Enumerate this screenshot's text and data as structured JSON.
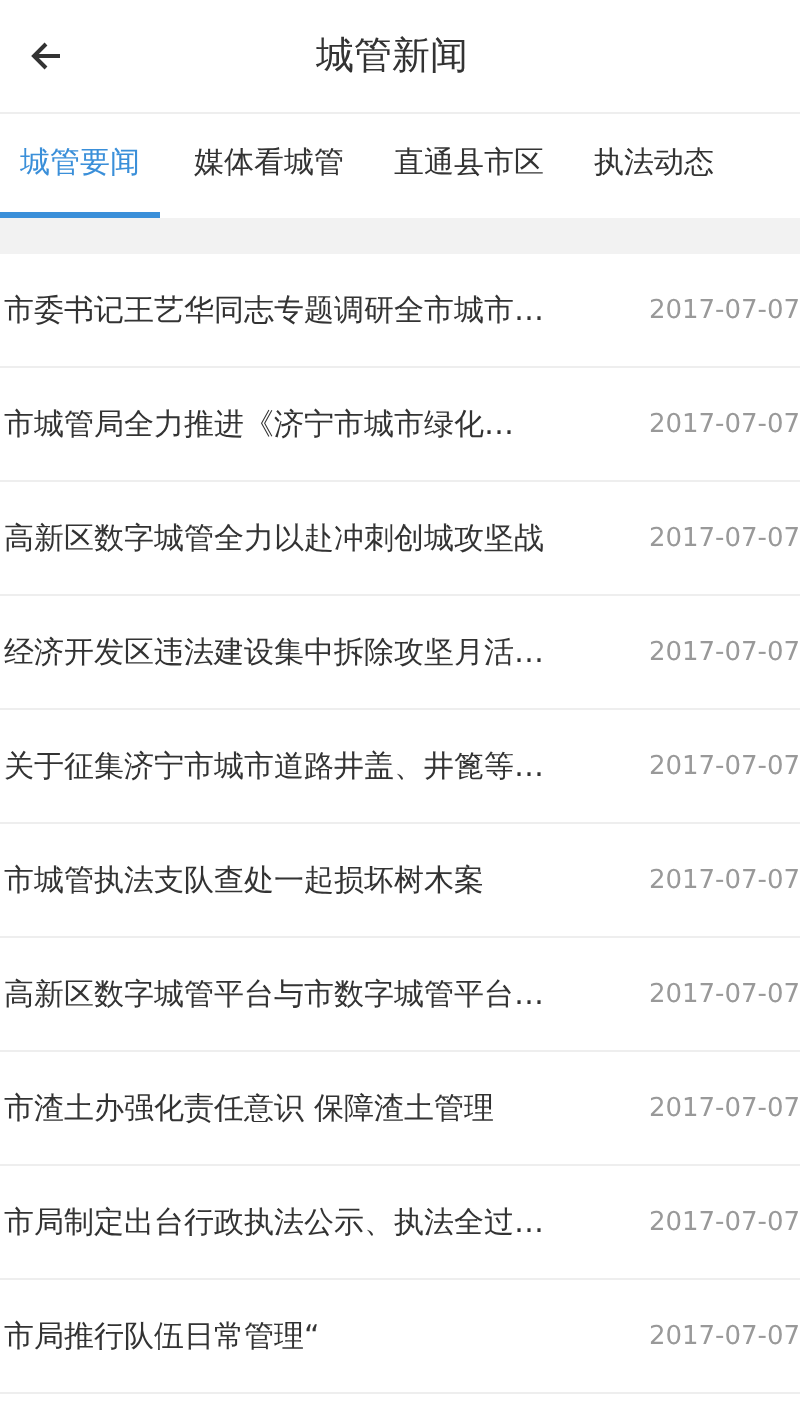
{
  "header": {
    "title": "城管新闻"
  },
  "tabs": [
    {
      "label": "城管要闻",
      "selected": true
    },
    {
      "label": "媒体看城管",
      "selected": false
    },
    {
      "label": "直通县市区",
      "selected": false
    },
    {
      "label": "执法动态",
      "selected": false
    }
  ],
  "news": [
    {
      "title": "市委书记王艺华同志专题调研全市城市…",
      "date": "2017-07-07"
    },
    {
      "title": "市城管局全力推进《济宁市城市绿化…",
      "date": "2017-07-07"
    },
    {
      "title": "高新区数字城管全力以赴冲刺创城攻坚战",
      "date": "2017-07-07"
    },
    {
      "title": "经济开发区违法建设集中拆除攻坚月活…",
      "date": "2017-07-07"
    },
    {
      "title": "关于征集济宁市城市道路井盖、井篦等…",
      "date": "2017-07-07"
    },
    {
      "title": "市城管执法支队查处一起损坏树木案",
      "date": "2017-07-07"
    },
    {
      "title": "高新区数字城管平台与市数字城管平台…",
      "date": "2017-07-07"
    },
    {
      "title": "市渣土办强化责任意识 保障渣土管理",
      "date": "2017-07-07"
    },
    {
      "title": "市局制定出台行政执法公示、执法全过…",
      "date": "2017-07-07"
    },
    {
      "title": "市局推行队伍日常管理“",
      "date": "2017-07-07"
    }
  ]
}
